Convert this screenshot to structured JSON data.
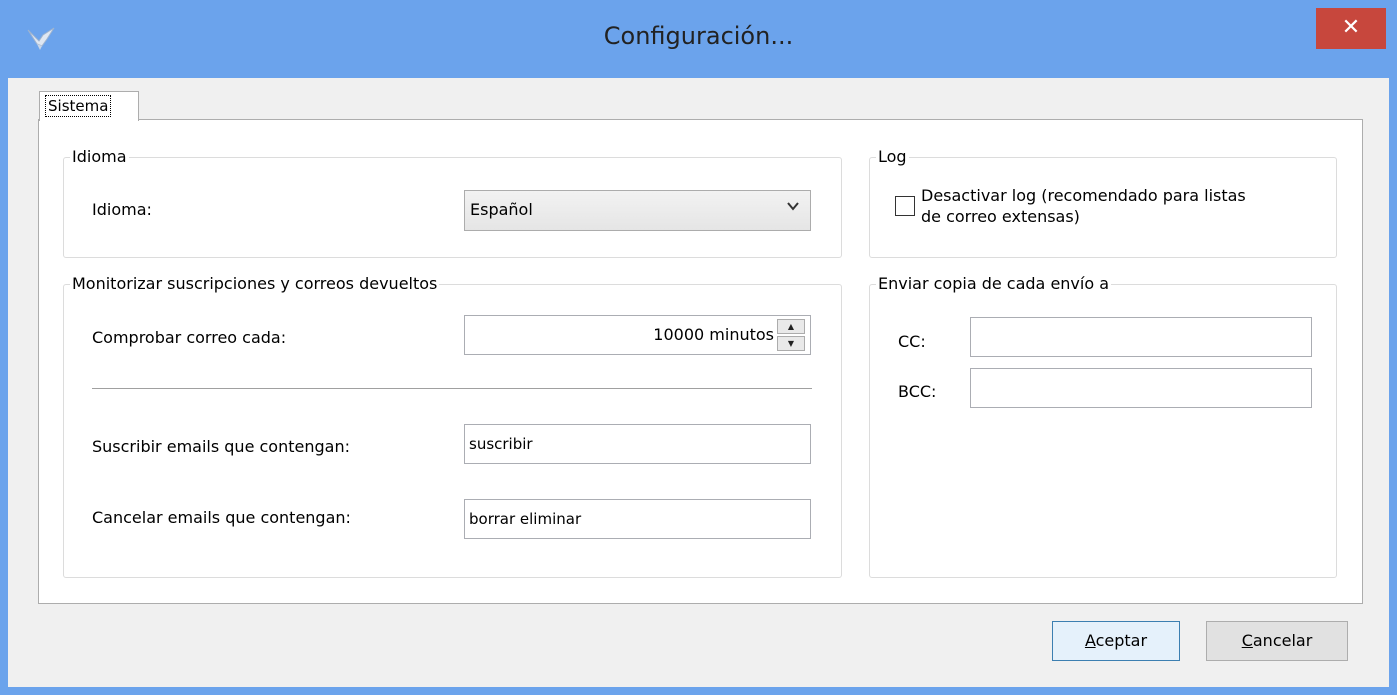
{
  "window": {
    "title": "Configuración...",
    "close_label": "✕"
  },
  "tabs": [
    {
      "label": "Sistema"
    }
  ],
  "idioma_group": {
    "legend": "Idioma",
    "label": "Idioma:",
    "selected": "Español"
  },
  "monitor_group": {
    "legend": "Monitorizar suscripciones y correos devueltos",
    "check_label": "Comprobar correo cada:",
    "check_value": "10000 minutos",
    "subscribe_label": "Suscribir emails que contengan:",
    "subscribe_value": "suscribir",
    "cancel_label": "Cancelar emails que contengan:",
    "cancel_value": "borrar  eliminar"
  },
  "log_group": {
    "legend": "Log",
    "checkbox_label_line1": "Desactivar log (recomendado para listas",
    "checkbox_label_line2": "de correo extensas)",
    "checked": false
  },
  "copy_group": {
    "legend": "Enviar copia de cada envío a",
    "cc_label": "CC:",
    "cc_value": "",
    "bcc_label": "BCC:",
    "bcc_value": ""
  },
  "buttons": {
    "accept_first": "A",
    "accept_rest": "ceptar",
    "cancel_first": "C",
    "cancel_rest": "ancelar"
  },
  "icons": {
    "app": "bird-icon",
    "close": "close-icon",
    "dropdown": "chevron-down-icon",
    "spin_up": "arrow-up-icon",
    "spin_down": "arrow-down-icon"
  },
  "colors": {
    "titlebar": "#6ba3ec",
    "close_button": "#c7473d",
    "dialog_background": "#f0f0f0",
    "default_button_border": "#3c7fb1"
  }
}
